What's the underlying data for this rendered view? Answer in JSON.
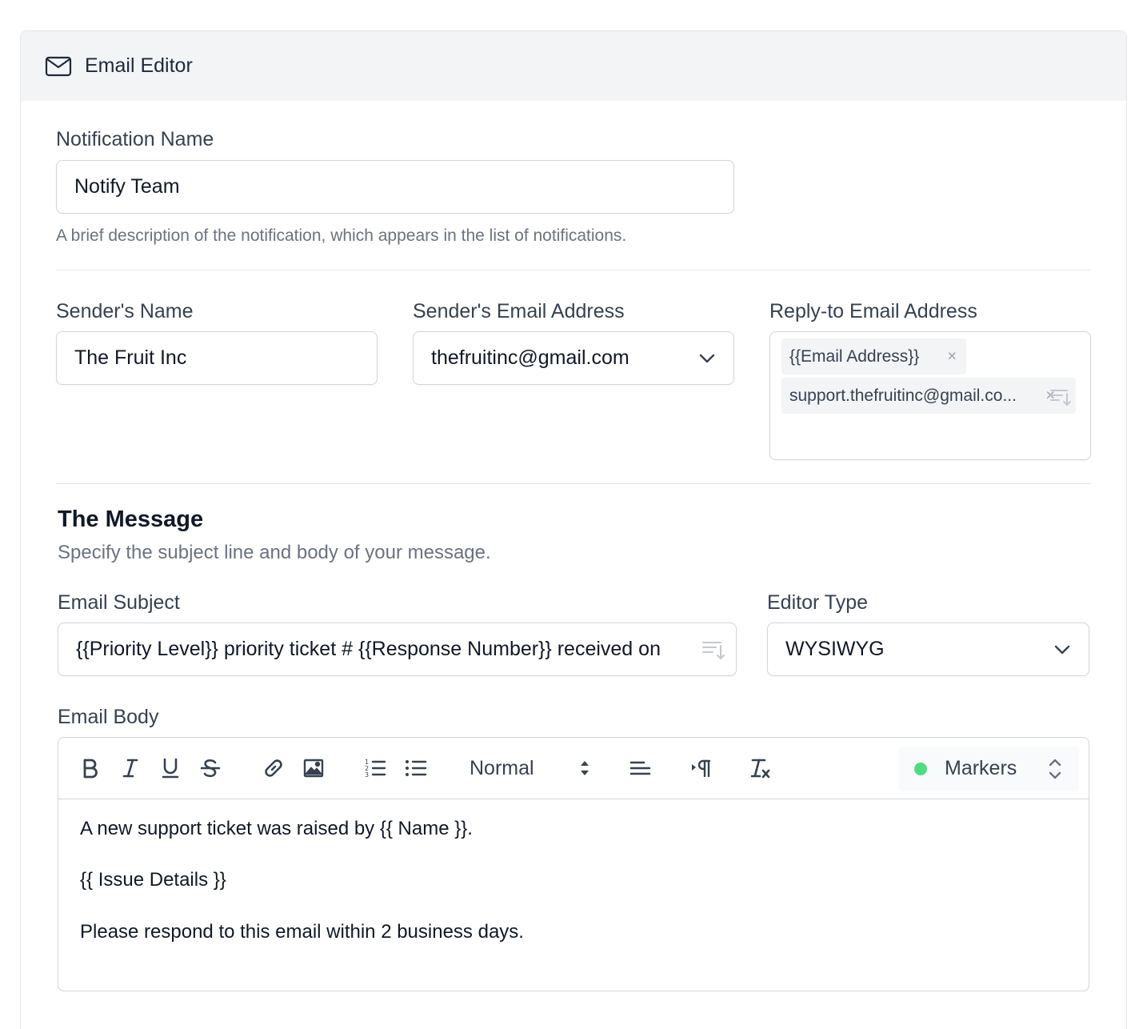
{
  "header": {
    "title": "Email Editor",
    "icon": "mail-icon"
  },
  "notification": {
    "label": "Notification Name",
    "value": "Notify Team",
    "help": "A brief description of the notification, which appears in the list of notifications."
  },
  "sender_name": {
    "label": "Sender's Name",
    "value": "The Fruit Inc"
  },
  "sender_email": {
    "label": "Sender's Email Address",
    "value": "thefruitinc@gmail.com"
  },
  "reply_to": {
    "label": "Reply-to Email Address",
    "tags": [
      {
        "text": "{{Email Address}}"
      },
      {
        "text": "support.thefruitinc@gmail.co..."
      }
    ],
    "remove_symbol": "×"
  },
  "message": {
    "title": "The Message",
    "subtitle": "Specify the subject line and body of your message."
  },
  "subject": {
    "label": "Email Subject",
    "value": "{{Priority Level}} priority ticket # {{Response Number}} received on"
  },
  "editor_type": {
    "label": "Editor Type",
    "value": "WYSIWYG"
  },
  "body": {
    "label": "Email Body",
    "toolbar": {
      "format": "Normal",
      "markers": "Markers",
      "icons": [
        "bold-icon",
        "italic-icon",
        "underline-icon",
        "strikethrough-icon",
        "link-icon",
        "image-icon",
        "ordered-list-icon",
        "bullet-list-icon",
        "align-icon",
        "text-direction-icon",
        "clear-format-icon"
      ]
    },
    "lines": [
      "A new support ticket was raised by {{ Name }}.",
      "{{ Issue Details }}",
      "Please respond to this email within 2 business days."
    ]
  },
  "colors": {
    "marker_dot": "#4ade80",
    "header_bg": "#f3f4f6",
    "border": "#d1d5db"
  }
}
